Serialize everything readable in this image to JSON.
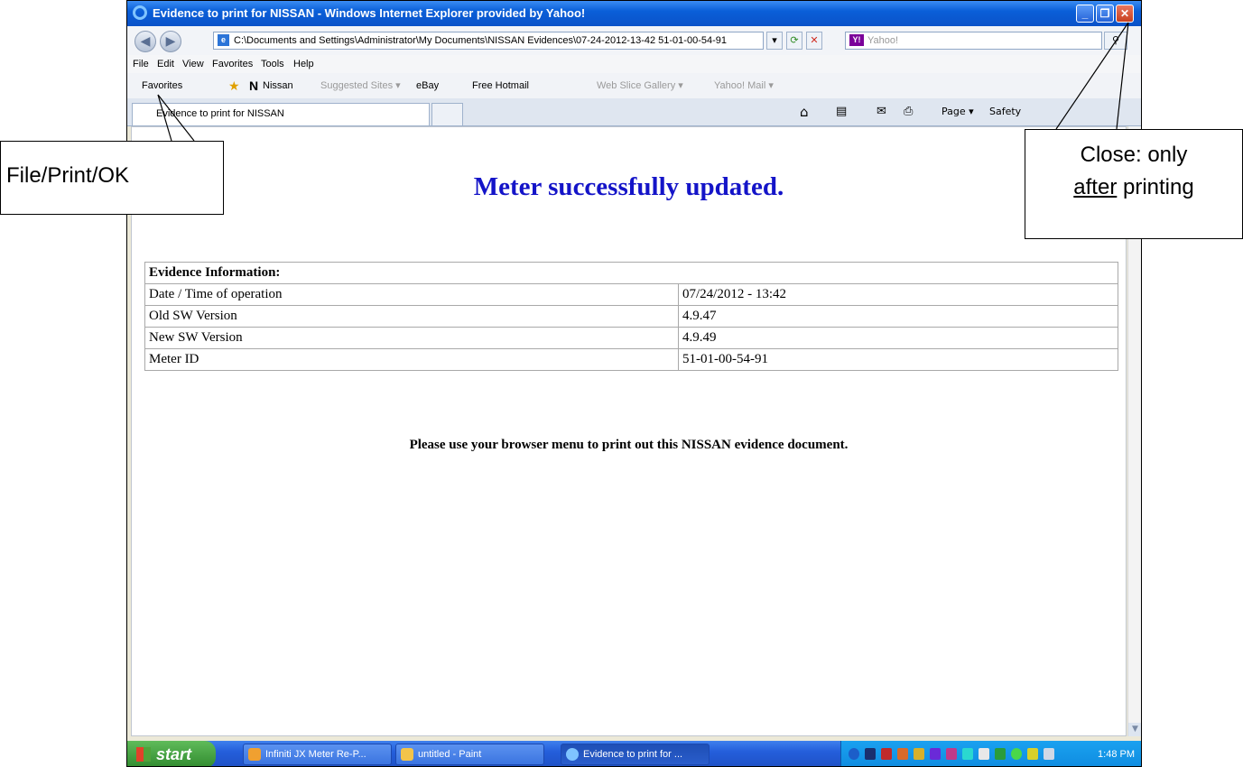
{
  "window": {
    "title": "Evidence to print for NISSAN - Windows Internet Explorer provided by Yahoo!",
    "minimize": "_",
    "restore": "❐",
    "close": "✕"
  },
  "address_bar": {
    "url": "C:\\Documents and Settings\\Administrator\\My Documents\\NISSAN Evidences\\07-24-2012-13-42 51-01-00-54-91",
    "search_logo": "Y!",
    "search_placeholder": "Yahoo!"
  },
  "menu": [
    "File",
    "Edit",
    "View",
    "Favorites",
    "Tools",
    "Help"
  ],
  "favorites_bar": {
    "favorites": "Favorites",
    "items": [
      "Nissan",
      "Suggested Sites ▾",
      "eBay",
      "Free Hotmail",
      "Web Slice Gallery ▾",
      "Yahoo! Mail ▾"
    ]
  },
  "tab": {
    "label": "Evidence to print for NISSAN"
  },
  "command_bar": {
    "page": "Page ▾",
    "safety": "Safety"
  },
  "page": {
    "heading": "Meter successfully updated.",
    "table_header": "Evidence Information:",
    "rows": [
      {
        "label": "Date / Time of operation",
        "value": "07/24/2012 - 13:42"
      },
      {
        "label": "Old SW Version",
        "value": "4.9.47"
      },
      {
        "label": "New SW Version",
        "value": "4.9.49"
      },
      {
        "label": "Meter ID",
        "value": "51-01-00-54-91"
      }
    ],
    "print_message": "Please use your browser menu to print out this NISSAN evidence document."
  },
  "taskbar": {
    "start": "start",
    "tasks": [
      "Infiniti JX Meter Re-P...",
      "untitled - Paint",
      "Evidence to print for ..."
    ],
    "clock": "1:48 PM"
  },
  "callouts": {
    "file_print": "File/Print/OK",
    "close_line1": "Close: only",
    "close_after": "after",
    "close_printing": " printing"
  }
}
